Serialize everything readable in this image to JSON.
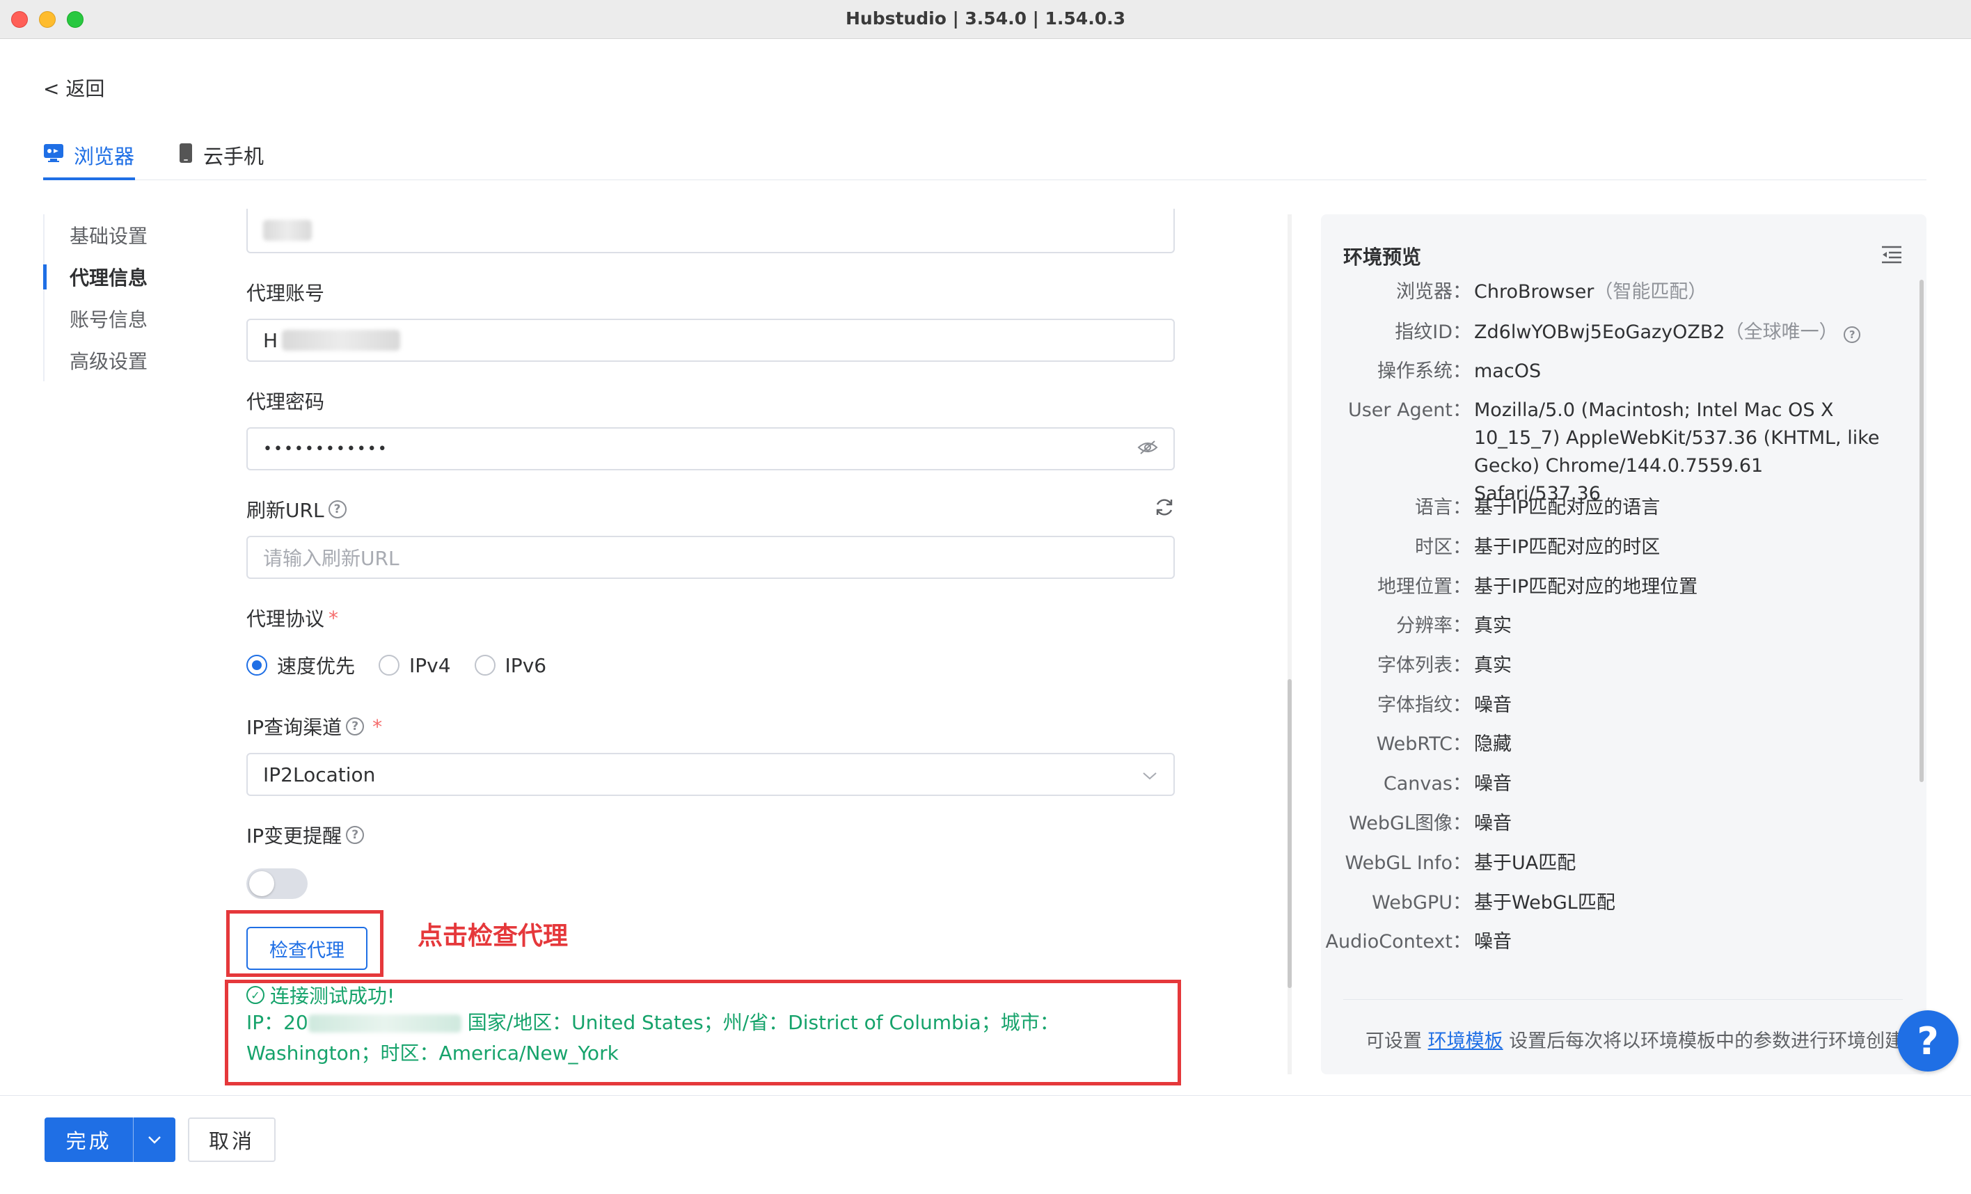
{
  "window": {
    "title": "Hubstudio | 3.54.0 | 1.54.0.3"
  },
  "back": {
    "label": "< 返回"
  },
  "tabs": [
    {
      "label": "浏览器"
    },
    {
      "label": "云手机"
    }
  ],
  "nav": [
    {
      "label": "基础设置"
    },
    {
      "label": "代理信息"
    },
    {
      "label": "账号信息"
    },
    {
      "label": "高级设置"
    }
  ],
  "form": {
    "top_field_value": "",
    "proxy_account_label": "代理账号",
    "proxy_account_value": "H",
    "proxy_password_label": "代理密码",
    "proxy_password_value": "••••••••••••",
    "refresh_url_label": "刷新URL",
    "refresh_url_placeholder": "请输入刷新URL",
    "protocol_label": "代理协议",
    "protocol_options": [
      "速度优先",
      "IPv4",
      "IPv6"
    ],
    "protocol_selected": "速度优先",
    "ip_channel_label": "IP查询渠道",
    "ip_channel_value": "IP2Location",
    "ip_change_label": "IP变更提醒",
    "ip_change_enabled": false,
    "check_proxy_label": "检查代理",
    "annotation": "点击检查代理",
    "success_text": "连接测试成功!",
    "ip_prefix": "IP：20",
    "ip_location_text": "国家/地区：United States；州/省：District of Columbia；城市：Washington；时区：America/New_York"
  },
  "preview": {
    "title": "环境预览",
    "rows": [
      {
        "key": "浏览器：",
        "value": "ChroBrowser",
        "note": "（智能匹配）"
      },
      {
        "key": "指纹ID：",
        "value": "Zd6lwYOBwj5EoGazyOZB2",
        "note": "（全球唯一）"
      },
      {
        "key": "操作系统：",
        "value": "macOS",
        "note": ""
      },
      {
        "key": "User Agent：",
        "value": "Mozilla/5.0 (Macintosh; Intel Mac OS X 10_15_7) AppleWebKit/537.36 (KHTML, like Gecko) Chrome/144.0.7559.61 Safari/537.36",
        "note": ""
      },
      {
        "key": "语言：",
        "value": "基于IP匹配对应的语言",
        "note": ""
      },
      {
        "key": "时区：",
        "value": "基于IP匹配对应的时区",
        "note": ""
      },
      {
        "key": "地理位置：",
        "value": "基于IP匹配对应的地理位置",
        "note": ""
      },
      {
        "key": "分辨率：",
        "value": "真实",
        "note": ""
      },
      {
        "key": "字体列表：",
        "value": "真实",
        "note": ""
      },
      {
        "key": "字体指纹：",
        "value": "噪音",
        "note": ""
      },
      {
        "key": "WebRTC：",
        "value": "隐藏",
        "note": ""
      },
      {
        "key": "Canvas：",
        "value": "噪音",
        "note": ""
      },
      {
        "key": "WebGL图像：",
        "value": "噪音",
        "note": ""
      },
      {
        "key": "WebGL Info：",
        "value": "基于UA匹配",
        "note": ""
      },
      {
        "key": "WebGPU：",
        "value": "基于WebGL匹配",
        "note": ""
      },
      {
        "key": "AudioContext：",
        "value": "噪音",
        "note": ""
      }
    ],
    "footer_prefix": "可设置",
    "footer_link": "环境模板",
    "footer_suffix": "设置后每次将以环境模板中的参数进行环境创建"
  },
  "help_label": "?",
  "actions": {
    "done_label": "完成",
    "cancel_label": "取消"
  },
  "colors": {
    "accent": "#1f6fe5",
    "success": "#16a36b",
    "annotation": "#e5383b"
  },
  "icons": [
    "browser-tab-icon",
    "phone-icon",
    "eye-off-icon",
    "question-icon",
    "refresh-icon",
    "chevron-down-icon",
    "check-circle-icon",
    "menu-indent-icon"
  ]
}
